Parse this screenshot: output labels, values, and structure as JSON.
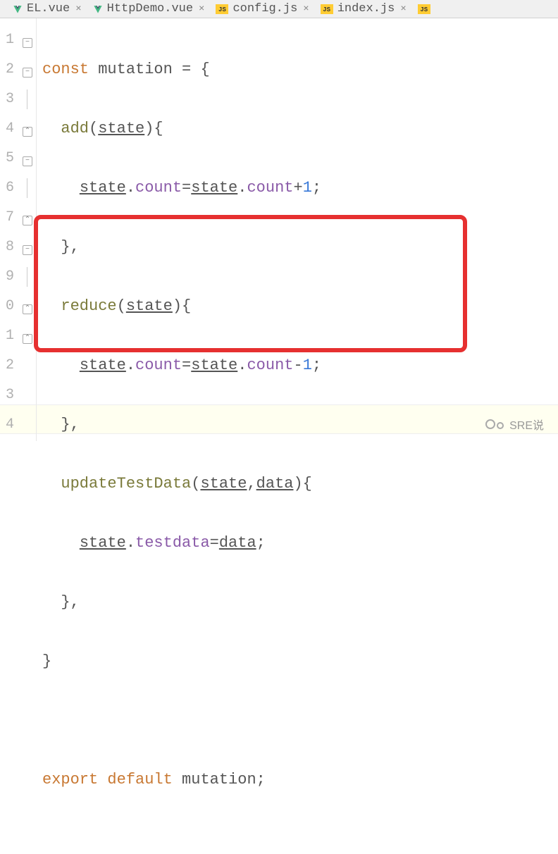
{
  "tabs": [
    {
      "icon": "vue",
      "name": "EL.vue"
    },
    {
      "icon": "vue",
      "name": "HttpDemo.vue"
    },
    {
      "icon": "js",
      "name": "config.js"
    },
    {
      "icon": "js",
      "name": "index.js"
    },
    {
      "icon": "js",
      "name": ""
    }
  ],
  "gutter": [
    "1",
    "2",
    "3",
    "4",
    "5",
    "6",
    "7",
    "8",
    "9",
    "0",
    "1",
    "2",
    "3",
    "4"
  ],
  "code": {
    "l1": {
      "kw1": "const",
      "id": "mutation",
      "op": "= {"
    },
    "l2": {
      "fn": "add",
      "p1": "(",
      "arg": "state",
      "p2": "){"
    },
    "l3": {
      "obj": "state",
      "dot": ".",
      "prop": "count",
      "eq": "=",
      "obj2": "state",
      "dot2": ".",
      "prop2": "count",
      "plus": "+",
      "num": "1",
      "semi": ";"
    },
    "l4": {
      "close": "},"
    },
    "l5": {
      "fn": "reduce",
      "p1": "(",
      "arg": "state",
      "p2": "){"
    },
    "l6": {
      "obj": "state",
      "dot": ".",
      "prop": "count",
      "eq": "=",
      "obj2": "state",
      "dot2": ".",
      "prop2": "count",
      "minus": "-",
      "num": "1",
      "semi": ";"
    },
    "l7": {
      "close": "},"
    },
    "l8": {
      "fn": "updateTestData",
      "p1": "(",
      "arg1": "state",
      "comma": ",",
      "arg2": "data",
      "p2": "){"
    },
    "l9": {
      "obj": "state",
      "dot": ".",
      "prop": "testdata",
      "eq": "=",
      "val": "data",
      "semi": ";"
    },
    "l10": {
      "close": "},"
    },
    "l11": {
      "close": "}"
    },
    "l12": "",
    "l13": {
      "kw1": "export",
      "kw2": "default",
      "id": "mutation",
      "semi": ";"
    }
  },
  "watermark": "SRE说",
  "js_badge": "JS"
}
